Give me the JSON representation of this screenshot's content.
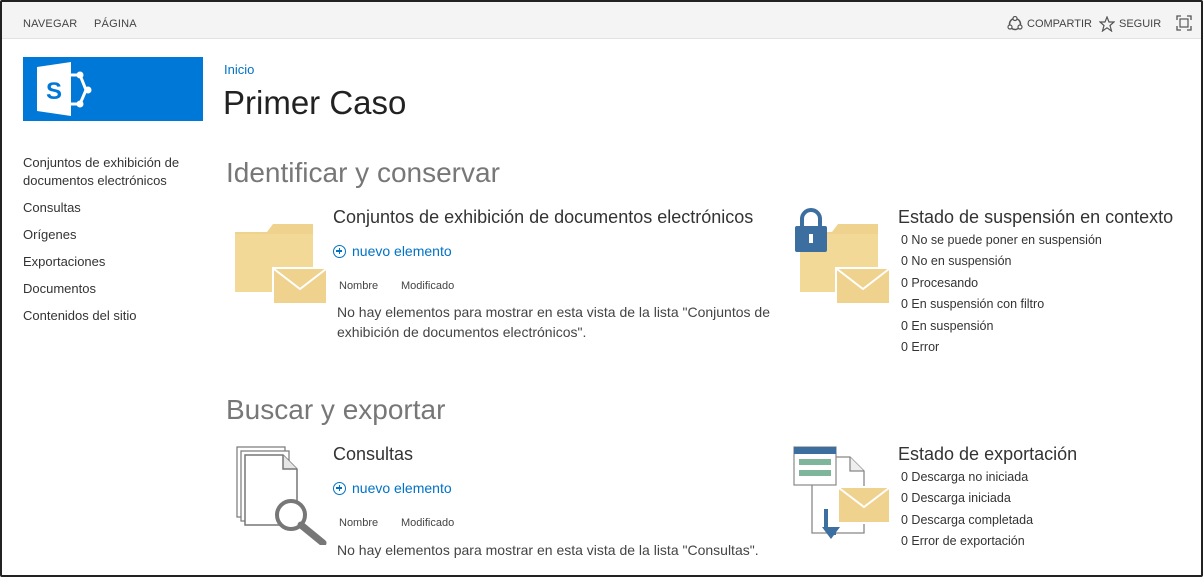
{
  "topbar": {
    "navegar": "NAVEGAR",
    "pagina": "PÁGINA",
    "compartir": "COMPARTIR",
    "seguir": "SEGUIR"
  },
  "breadcrumb": "Inicio",
  "page_title": "Primer Caso",
  "leftnav": {
    "items": [
      {
        "label": "Conjuntos de exhibición de documentos electrónicos"
      },
      {
        "label": "Consultas"
      },
      {
        "label": "Orígenes"
      },
      {
        "label": "Exportaciones"
      },
      {
        "label": "Documentos"
      },
      {
        "label": "Contenidos del sitio"
      }
    ]
  },
  "sections": {
    "identify": {
      "title": "Identificar y conservar",
      "list": {
        "title": "Conjuntos de exhibición de documentos electrónicos",
        "new_item": "nuevo elemento",
        "col_name": "Nombre",
        "col_modified": "Modificado",
        "empty": "No hay elementos para mostrar en esta vista de la lista \"Conjuntos de exhibición de documentos electrónicos\"."
      },
      "status": {
        "title": "Estado de suspensión en contexto",
        "rows": [
          "0 No se puede poner en suspensión",
          "0 No en suspensión",
          "0 Procesando",
          "0 En suspensión con filtro",
          "0 En suspensión",
          "0 Error"
        ]
      }
    },
    "search": {
      "title": "Buscar y exportar",
      "list": {
        "title": "Consultas",
        "new_item": "nuevo elemento",
        "col_name": "Nombre",
        "col_modified": "Modificado",
        "empty": "No hay elementos para mostrar en esta vista de la lista \"Consultas\"."
      },
      "status": {
        "title": "Estado de exportación",
        "rows": [
          "0 Descarga no iniciada",
          "0 Descarga iniciada",
          "0 Descarga completada",
          "0 Error de exportación"
        ]
      }
    }
  },
  "colors": {
    "brand": "#0078d7",
    "link": "#0072c6",
    "folder": "#f0d28f"
  }
}
